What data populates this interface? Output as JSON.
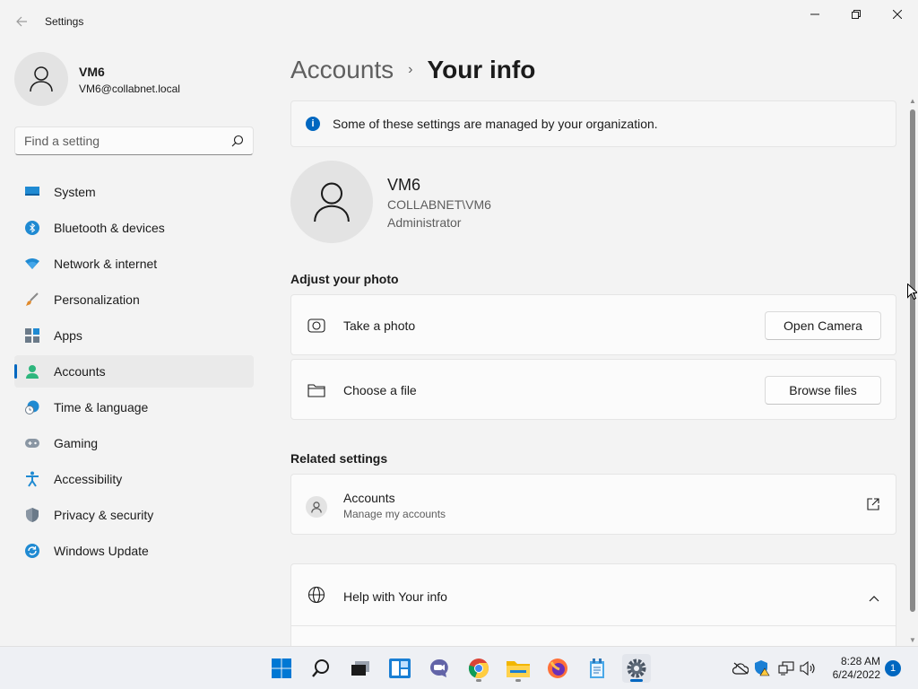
{
  "window": {
    "title": "Settings"
  },
  "profile": {
    "name": "VM6",
    "email": "VM6@collabnet.local"
  },
  "search": {
    "placeholder": "Find a setting"
  },
  "nav": {
    "items": [
      {
        "label": "System",
        "icon": "monitor-icon"
      },
      {
        "label": "Bluetooth & devices",
        "icon": "bluetooth-icon"
      },
      {
        "label": "Network & internet",
        "icon": "wifi-icon"
      },
      {
        "label": "Personalization",
        "icon": "brush-icon"
      },
      {
        "label": "Apps",
        "icon": "apps-icon"
      },
      {
        "label": "Accounts",
        "icon": "person-icon",
        "active": true
      },
      {
        "label": "Time & language",
        "icon": "globe-clock-icon"
      },
      {
        "label": "Gaming",
        "icon": "gamepad-icon"
      },
      {
        "label": "Accessibility",
        "icon": "accessibility-icon"
      },
      {
        "label": "Privacy & security",
        "icon": "shield-icon"
      },
      {
        "label": "Windows Update",
        "icon": "update-icon"
      }
    ]
  },
  "breadcrumb": {
    "parent": "Accounts",
    "separator": "›",
    "current": "Your info"
  },
  "info_bar": {
    "text": "Some of these settings are managed by your organization.",
    "icon": "i"
  },
  "user": {
    "name": "VM6",
    "domain": "COLLABNET\\VM6",
    "role": "Administrator"
  },
  "adjust_photo": {
    "heading": "Adjust your photo",
    "take_photo": {
      "label": "Take a photo",
      "button": "Open Camera"
    },
    "choose_file": {
      "label": "Choose a file",
      "button": "Browse files"
    }
  },
  "related": {
    "heading": "Related settings",
    "accounts": {
      "label": "Accounts",
      "sub": "Manage my accounts"
    }
  },
  "help": {
    "label": "Help with Your info"
  },
  "scroll": {
    "up": "▲",
    "down": "▼"
  },
  "clock": {
    "time": "8:28 AM",
    "date": "6/24/2022"
  },
  "notifications": {
    "count": "1"
  },
  "colors": {
    "accent": "#0067c0",
    "background": "#f3f3f3",
    "card": "#fbfbfb"
  }
}
